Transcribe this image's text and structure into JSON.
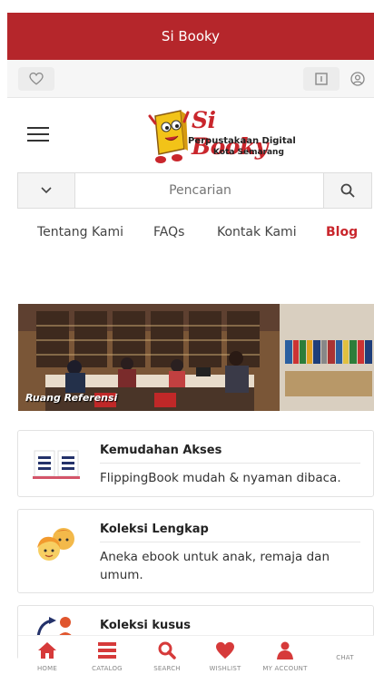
{
  "appbar": {
    "title": "Si Booky"
  },
  "logo": {
    "title": "Si Booky",
    "line1": "Perpustakaan Digital",
    "line2": "Kota Semarang"
  },
  "search": {
    "placeholder": "Pencarian"
  },
  "menu": [
    {
      "label": "Tentang Kami",
      "active": false
    },
    {
      "label": "FAQs",
      "active": false
    },
    {
      "label": "Kontak Kami",
      "active": false
    },
    {
      "label": "Blog",
      "active": true
    }
  ],
  "banner": {
    "caption": "Ruang Referensi"
  },
  "features": [
    {
      "title": "Kemudahan Akses",
      "desc": "FlippingBook mudah & nyaman dibaca.",
      "icon": "open-book-icon"
    },
    {
      "title": "Koleksi Lengkap",
      "desc": "Aneka ebook untuk anak, remaja dan umum.",
      "icon": "children-faces-icon"
    },
    {
      "title": "Koleksi kusus",
      "desc": "",
      "icon": "reader-icon"
    }
  ],
  "bottom_nav": [
    {
      "label": "HOME",
      "icon": "home-icon"
    },
    {
      "label": "CATALOG",
      "icon": "list-icon"
    },
    {
      "label": "SEARCH",
      "icon": "search-icon"
    },
    {
      "label": "WISHLIST",
      "icon": "heart-icon"
    },
    {
      "label": "MY ACCOUNT",
      "icon": "user-icon"
    },
    {
      "label": "CHAT",
      "icon": "chat-icon"
    }
  ],
  "colors": {
    "brand": "#b5262b",
    "accent": "#c9262c"
  }
}
